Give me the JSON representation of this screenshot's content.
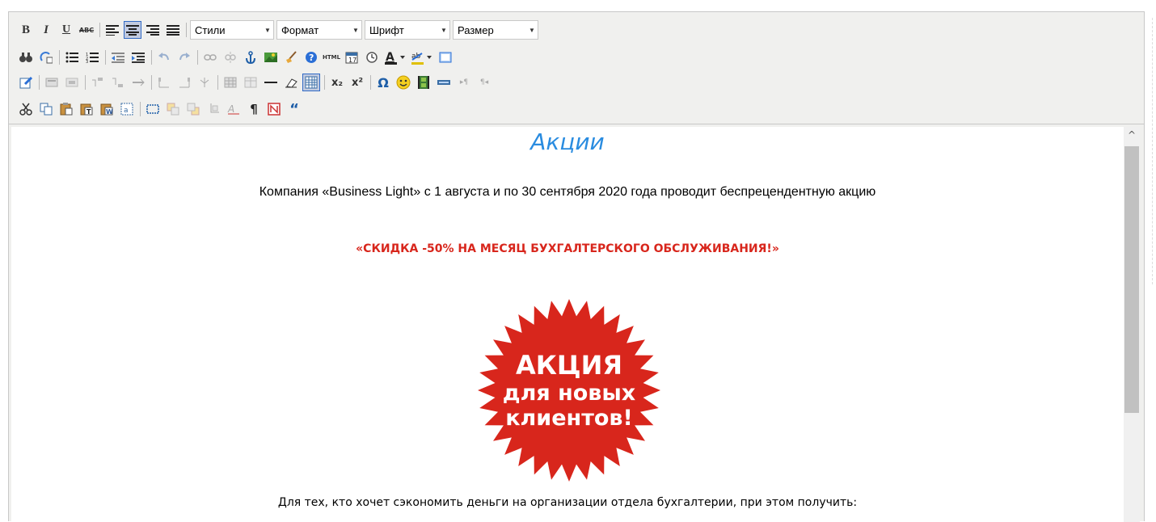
{
  "toolbar": {
    "dropdowns": {
      "styles": "Стили",
      "format": "Формат",
      "font": "Шрифт",
      "size": "Размер"
    },
    "superscript_label": "x²",
    "subscript_label": "x₂"
  },
  "content": {
    "heading": "Акции",
    "intro": "Компания «Business Light» с 1 августа и по 30 сентября 2020 года проводит беспрецендентную акцию",
    "promo": "«СКИДКА -50% НА МЕСЯЦ БУХГАЛТЕРСКОГО ОБСЛУЖИВАНИЯ!»",
    "badge": {
      "line1": "АКЦИЯ",
      "line2": "для новых",
      "line3": "клиентов!",
      "color": "#d8261c"
    },
    "footer_text": "Для тех, кто хочет сэкономить деньги на организации отдела бухгалтерии, при этом получить:"
  },
  "colors": {
    "heading": "#2a8ce0",
    "promo": "#d8261c"
  }
}
